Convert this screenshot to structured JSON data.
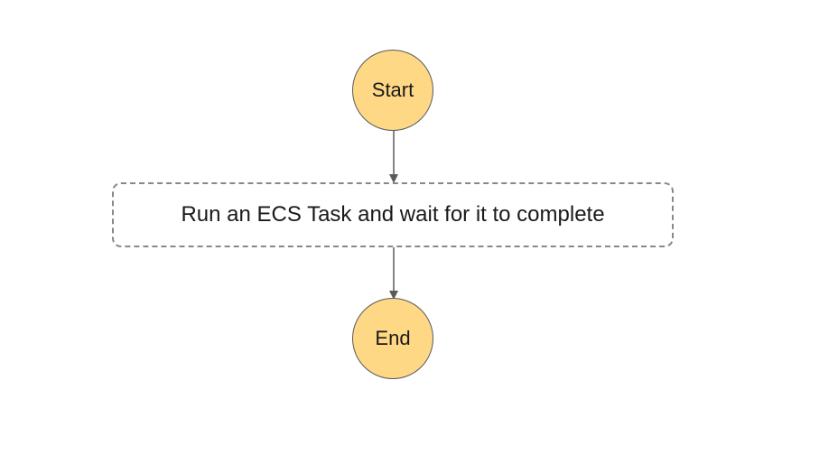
{
  "diagram": {
    "start_label": "Start",
    "task_label": "Run an ECS Task and wait for it to complete",
    "end_label": "End"
  },
  "colors": {
    "circle_fill": "#ffd886",
    "circle_stroke": "#5a5a5a",
    "box_stroke": "#888888",
    "arrow_stroke": "#5a5a5a",
    "text": "#1a1a1a"
  }
}
